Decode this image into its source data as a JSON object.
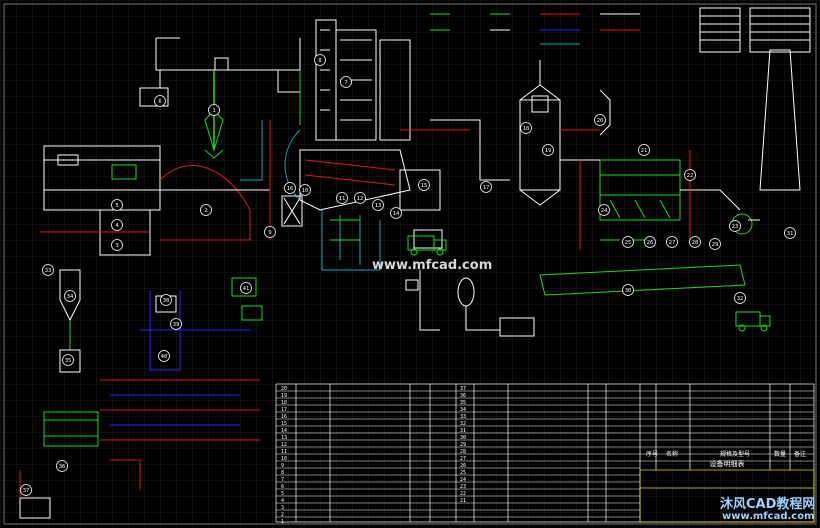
{
  "canvas": {
    "background": "#000000",
    "grid_color": "#1e1e1e"
  },
  "colors": {
    "white": "#ffffff",
    "green": "#18e018",
    "cyan": "#14a8b8",
    "red": "#e01818",
    "blue": "#2828ff",
    "yellow": "#e8e818",
    "gray": "#9a9a9a"
  },
  "callouts": [
    "1",
    "2",
    "3",
    "4",
    "5",
    "6",
    "7",
    "8",
    "9",
    "10",
    "11",
    "12",
    "13",
    "14",
    "15",
    "16",
    "17",
    "18",
    "19",
    "20",
    "21",
    "22",
    "23",
    "24",
    "25",
    "26",
    "27",
    "28",
    "29",
    "30",
    "31",
    "32",
    "33",
    "34",
    "35",
    "36",
    "37",
    "38",
    "39",
    "40",
    "41",
    "42",
    "43",
    "44",
    "45",
    "46",
    "47"
  ],
  "table": {
    "row_numbers_col1": [
      "20",
      "19",
      "18",
      "17",
      "16",
      "15",
      "14",
      "13",
      "12",
      "11",
      "10",
      "9",
      "8",
      "7",
      "6",
      "5",
      "4",
      "3",
      "2",
      "1"
    ],
    "row_numbers_col2": [
      "37",
      "36",
      "35",
      "34",
      "33",
      "32",
      "31",
      "30",
      "29",
      "28",
      "27",
      "26",
      "25",
      "24",
      "23",
      "22",
      "21"
    ],
    "footer_labels": [
      "序号",
      "名称",
      "规格及型号",
      "数量",
      "备注"
    ],
    "title": "设备明细表"
  },
  "watermarks": {
    "center": "www.mfcad.com",
    "corner_cn": "沐风CAD教程网",
    "corner_url": "www.mfcad.com"
  }
}
